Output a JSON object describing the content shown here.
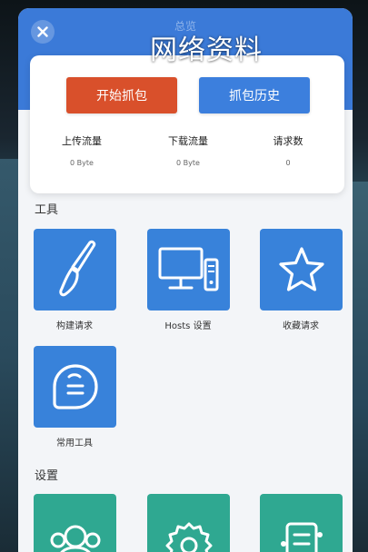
{
  "header": {
    "title": "总览",
    "close_icon": "close-icon",
    "accent": "#3b7ad8"
  },
  "watermark": "网络资料",
  "stats_card": {
    "start_button": "开始抓包",
    "history_button": "抓包历史",
    "start_color": "#d9502b",
    "history_color": "#3c7fdd",
    "stats": [
      {
        "label": "上传流量",
        "value": "0 Byte"
      },
      {
        "label": "下载流量",
        "value": "0 Byte"
      },
      {
        "label": "请求数",
        "value": "0"
      }
    ]
  },
  "tools": {
    "title": "工具",
    "items": [
      {
        "label": "构建请求",
        "icon": "brush-icon"
      },
      {
        "label": "Hosts 设置",
        "icon": "computer-icon"
      },
      {
        "label": "收藏请求",
        "icon": "star-icon"
      },
      {
        "label": "常用工具",
        "icon": "tools-icon"
      }
    ],
    "tile_color": "#3882da"
  },
  "settings": {
    "title": "设置",
    "items": [
      {
        "icon": "users-icon"
      },
      {
        "icon": "gear-icon"
      },
      {
        "icon": "document-icon"
      }
    ],
    "tile_color": "#2fa891"
  }
}
